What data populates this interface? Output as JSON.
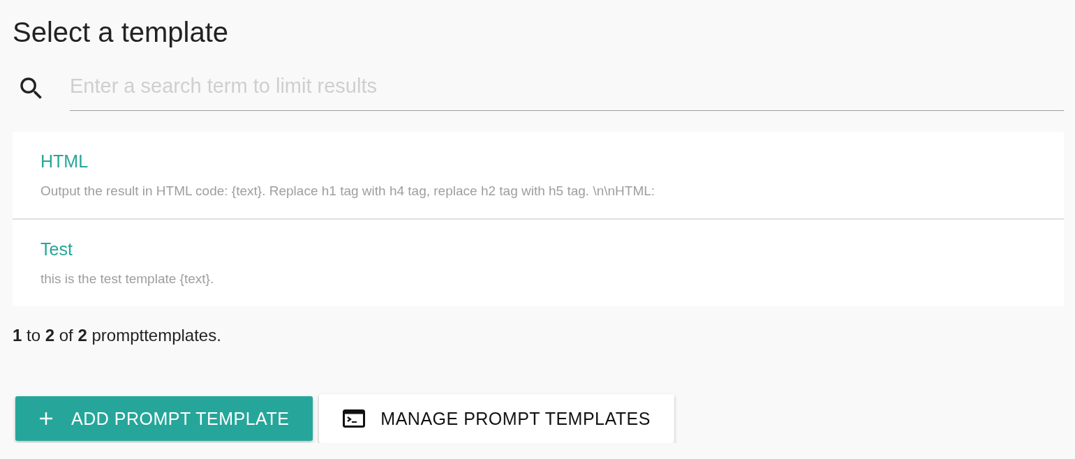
{
  "title": "Select a template",
  "search": {
    "placeholder": "Enter a search term to limit results"
  },
  "templates": [
    {
      "name": "HTML",
      "description": "Output the result in HTML code: {text}. Replace h1 tag with h4 tag, replace h2 tag with h5 tag. \\n\\nHTML:"
    },
    {
      "name": "Test",
      "description": "this is the test template {text}."
    }
  ],
  "summary": "**1** to **2** of **2** prompttemplates.",
  "buttons": [
    {
      "kind": "add",
      "label": "ADD PROMPT TEMPLATE"
    },
    {
      "kind": "manage",
      "label": "MANAGE PROMPT TEMPLATES"
    }
  ]
}
